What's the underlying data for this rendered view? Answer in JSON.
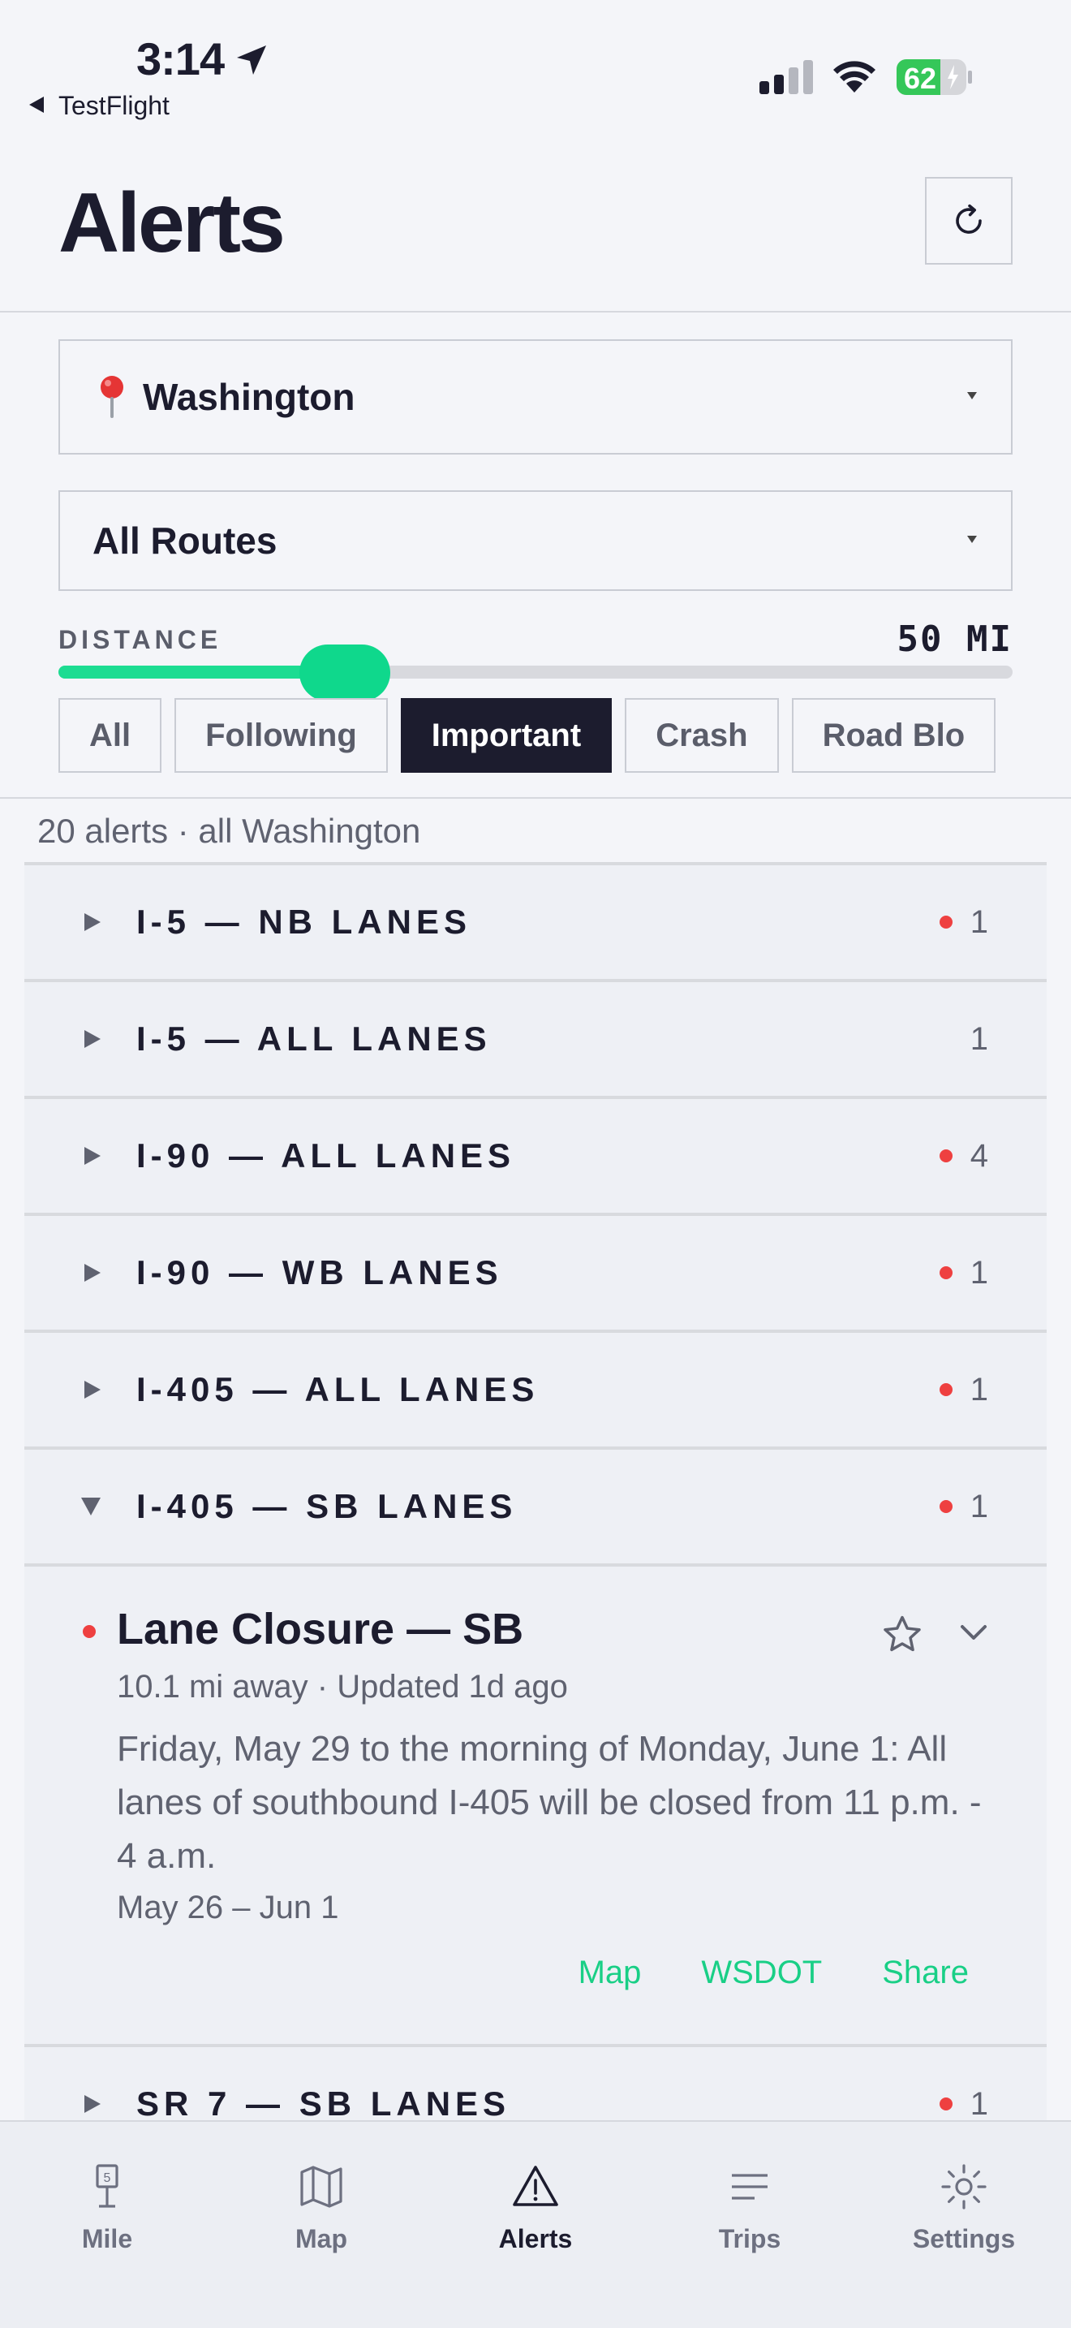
{
  "status_bar": {
    "time": "3:14",
    "back_app": "TestFlight",
    "battery": "62"
  },
  "header": {
    "title": "Alerts",
    "refresh_icon": "refresh-icon"
  },
  "filters": {
    "region": "Washington",
    "region_icon": "pin-icon",
    "route": "All Routes",
    "distance_label": "DISTANCE",
    "distance_value": "50 MI",
    "distance_fraction": 0.3,
    "chips": [
      {
        "label": "All",
        "active": false
      },
      {
        "label": "Following",
        "active": false
      },
      {
        "label": "Important",
        "active": true
      },
      {
        "label": "Crash",
        "active": false
      },
      {
        "label": "Road Blo",
        "active": false
      }
    ]
  },
  "summary": "20 alerts · all Washington",
  "groups": [
    {
      "name": "I-5 — NB LANES",
      "count": "1",
      "alert": true,
      "expanded": false
    },
    {
      "name": "I-5 — ALL LANES",
      "count": "1",
      "alert": false,
      "expanded": false
    },
    {
      "name": "I-90 — ALL LANES",
      "count": "4",
      "alert": true,
      "expanded": false
    },
    {
      "name": "I-90 — WB LANES",
      "count": "1",
      "alert": true,
      "expanded": false
    },
    {
      "name": "I-405 — ALL LANES",
      "count": "1",
      "alert": true,
      "expanded": false
    },
    {
      "name": "I-405 — SB LANES",
      "count": "1",
      "alert": true,
      "expanded": true
    },
    {
      "name": "SR 7 — SB LANES",
      "count": "1",
      "alert": true,
      "expanded": false
    }
  ],
  "alert_card": {
    "title": "Lane Closure — SB",
    "meta": "10.1 mi away · Updated 1d ago",
    "body": "Friday, May 29 to the morning of Monday, June 1: All lanes of southbound I-405 will be closed from 11 p.m. - 4 a.m.",
    "dates": "May 26 – Jun 1",
    "links": [
      "Map",
      "WSDOT",
      "Share"
    ]
  },
  "tabs": [
    {
      "label": "Mile",
      "icon": "milepost-icon",
      "active": false,
      "badge": "5"
    },
    {
      "label": "Map",
      "icon": "map-icon",
      "active": false
    },
    {
      "label": "Alerts",
      "icon": "warning-icon",
      "active": true
    },
    {
      "label": "Trips",
      "icon": "list-icon",
      "active": false
    },
    {
      "label": "Settings",
      "icon": "gear-icon",
      "active": false
    }
  ],
  "colors": {
    "accent": "#19cf86",
    "alert_dot": "#ee4040",
    "dark": "#1c1c2e"
  }
}
